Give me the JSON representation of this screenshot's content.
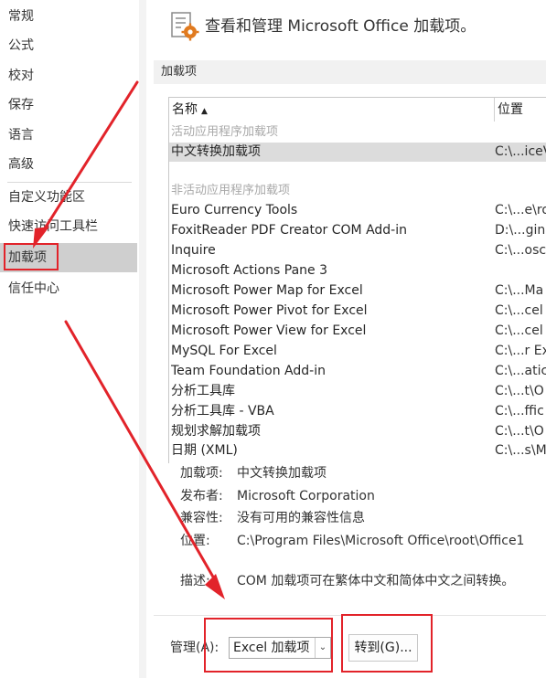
{
  "nav": {
    "items": [
      {
        "label": "常规"
      },
      {
        "label": "公式"
      },
      {
        "label": "校对"
      },
      {
        "label": "保存"
      },
      {
        "label": "语言"
      },
      {
        "label": "高级"
      },
      {
        "label": "自定义功能区"
      },
      {
        "label": "快速访问工具栏"
      },
      {
        "label": "加载项"
      },
      {
        "label": "信任中心"
      }
    ],
    "selected": "加载项"
  },
  "header": {
    "title": "查看和管理 Microsoft Office 加载项。",
    "icon": "gear-document-icon"
  },
  "section": {
    "title": "加载项"
  },
  "list": {
    "col_name": "名称",
    "col_location": "位置",
    "active_group": "活动应用程序加载项",
    "active_items": [
      {
        "name": "中文转换加载项",
        "location": "C:\\...iceV"
      }
    ],
    "inactive_group": "非活动应用程序加载项",
    "inactive_items": [
      {
        "name": "Euro Currency Tools",
        "location": "C:\\...e\\ro"
      },
      {
        "name": "FoxitReader PDF Creator COM Add-in",
        "location": "D:\\...gin"
      },
      {
        "name": "Inquire",
        "location": "C:\\...osc"
      },
      {
        "name": "Microsoft Actions Pane 3",
        "location": ""
      },
      {
        "name": "Microsoft Power Map for Excel",
        "location": "C:\\...Ma"
      },
      {
        "name": "Microsoft Power Pivot for Excel",
        "location": "C:\\...cel"
      },
      {
        "name": "Microsoft Power View for Excel",
        "location": "C:\\...cel"
      },
      {
        "name": "MySQL For Excel",
        "location": "C:\\...r Ex"
      },
      {
        "name": "Team Foundation Add-in",
        "location": "C:\\...atic"
      },
      {
        "name": "分析工具库",
        "location": "C:\\...t\\O"
      },
      {
        "name": "分析工具库 - VBA",
        "location": "C:\\...ffic"
      },
      {
        "name": "规划求解加载项",
        "location": "C:\\...t\\O"
      },
      {
        "name": "日期 (XML)",
        "location": "C:\\...s\\M"
      }
    ]
  },
  "details": {
    "addin_label": "加载项:",
    "addin_value": "中文转换加载项",
    "publisher_label": "发布者:",
    "publisher_value": "Microsoft Corporation",
    "compat_label": "兼容性:",
    "compat_value": "没有可用的兼容性信息",
    "location_label": "位置:",
    "location_value": "C:\\Program Files\\Microsoft Office\\root\\Office1",
    "desc_label": "描述:",
    "desc_value": "COM 加载项可在繁体中文和简体中文之间转换。"
  },
  "manage": {
    "label": "管理(A):",
    "select_value": "Excel 加载项",
    "go_button": "转到(G)..."
  },
  "colors": {
    "annotation_red": "#e2232a",
    "selected_bg": "#cfcfcf"
  }
}
